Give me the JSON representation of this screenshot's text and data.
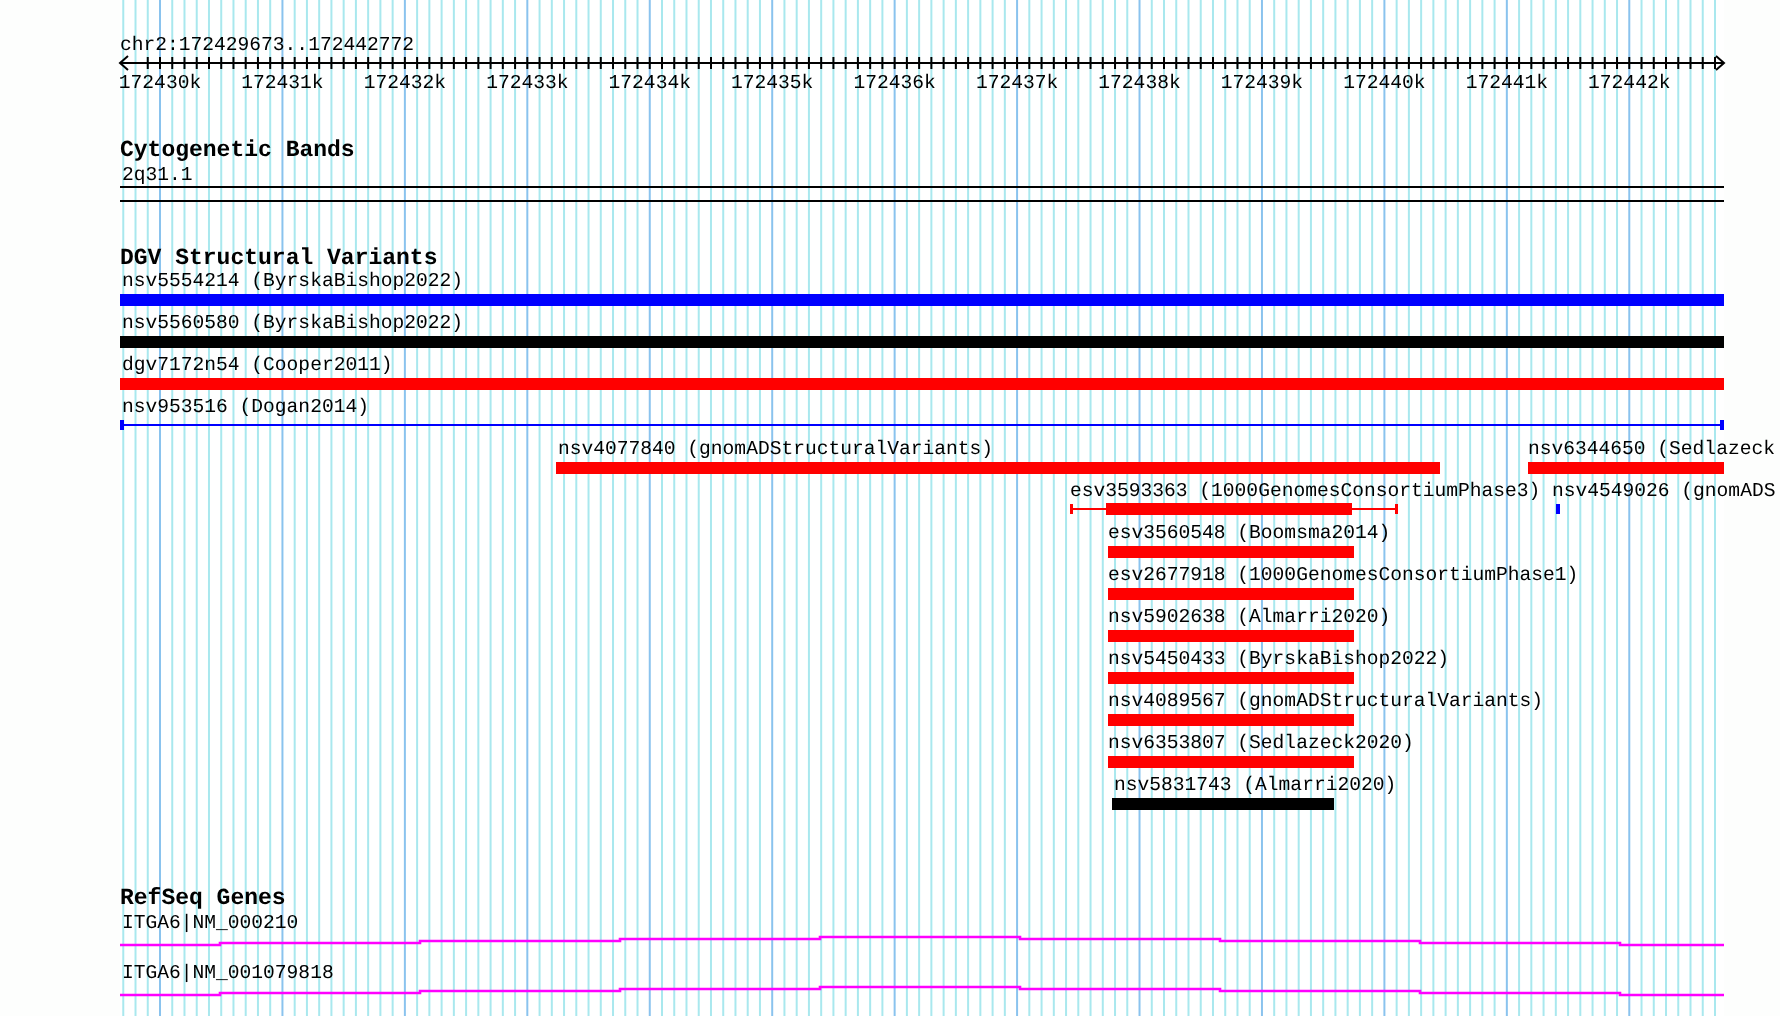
{
  "ruler": {
    "range": "chr2:172429673..172442772",
    "ticks": [
      "172430k",
      "172431k",
      "172432k",
      "172433k",
      "172434k",
      "172435k",
      "172436k",
      "172437k",
      "172438k",
      "172439k",
      "172440k",
      "172441k",
      "172442k"
    ]
  },
  "tracks": [
    {
      "title": "Cytogenetic Bands",
      "features": [
        {
          "label": "2q31.1",
          "kind": "band"
        }
      ]
    },
    {
      "title": "DGV Structural Variants",
      "features": [
        {
          "label": "nsv5554214 (ByrskaBishop2022)",
          "kind": "bar",
          "color": "#0000ff"
        },
        {
          "label": "nsv5560580 (ByrskaBishop2022)",
          "kind": "bar",
          "color": "#000000"
        },
        {
          "label": "dgv7172n54 (Cooper2011)",
          "kind": "bar",
          "color": "#ff0000"
        },
        {
          "label": "nsv953516 (Dogan2014)",
          "kind": "thin",
          "color": "#0000ff"
        },
        {
          "label": "nsv4077840 (gnomADStructuralVariants)",
          "kind": "bar",
          "color": "#ff0000"
        },
        {
          "label": "nsv6344650 (Sedlazeck",
          "kind": "bar",
          "color": "#ff0000"
        },
        {
          "label": "esv3593363 (1000GenomesConsortiumPhase3)",
          "kind": "whisker",
          "color": "#ff0000"
        },
        {
          "label": "nsv4549026 (gnomADS",
          "kind": "thin",
          "color": "#0000ff"
        },
        {
          "label": "esv3560548 (Boomsma2014)",
          "kind": "bar",
          "color": "#ff0000"
        },
        {
          "label": "esv2677918 (1000GenomesConsortiumPhase1)",
          "kind": "bar",
          "color": "#ff0000"
        },
        {
          "label": "nsv5902638 (Almarri2020)",
          "kind": "bar",
          "color": "#ff0000"
        },
        {
          "label": "nsv5450433 (ByrskaBishop2022)",
          "kind": "bar",
          "color": "#ff0000"
        },
        {
          "label": "nsv4089567 (gnomADStructuralVariants)",
          "kind": "bar",
          "color": "#ff0000"
        },
        {
          "label": "nsv6353807 (Sedlazeck2020)",
          "kind": "bar",
          "color": "#ff0000"
        },
        {
          "label": "nsv5831743 (Almarri2020)",
          "kind": "bar",
          "color": "#000000"
        }
      ]
    },
    {
      "title": "RefSeq Genes",
      "features": [
        {
          "label": "ITGA6|NM_000210",
          "kind": "gene"
        },
        {
          "label": "ITGA6|NM_001079818",
          "kind": "gene"
        }
      ]
    }
  ]
}
